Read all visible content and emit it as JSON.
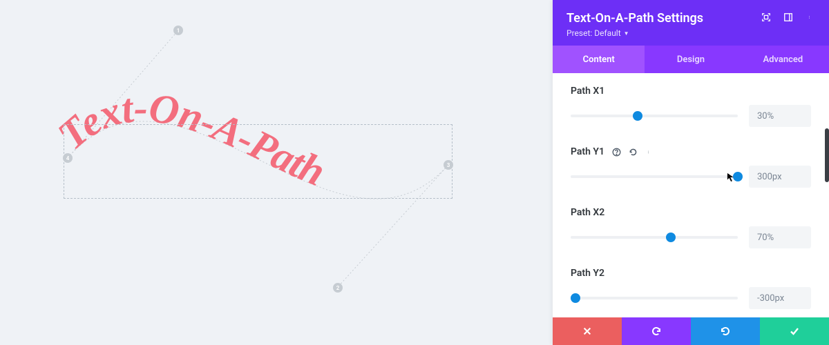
{
  "canvas": {
    "displayText": "Text-On-A-Path",
    "nodes": [
      "1",
      "2",
      "3",
      "4"
    ]
  },
  "header": {
    "title": "Text-On-A-Path Settings",
    "presetLabel": "Preset: Default"
  },
  "tabs": {
    "content": "Content",
    "design": "Design",
    "advanced": "Advanced"
  },
  "fields": {
    "x1": {
      "label": "Path X1",
      "value": "30%",
      "pct": 40
    },
    "y1": {
      "label": "Path Y1",
      "value": "300px",
      "pct": 100
    },
    "x2": {
      "label": "Path X2",
      "value": "70%",
      "pct": 60
    },
    "y2": {
      "label": "Path Y2",
      "value": "-300px",
      "pct": 3
    }
  }
}
